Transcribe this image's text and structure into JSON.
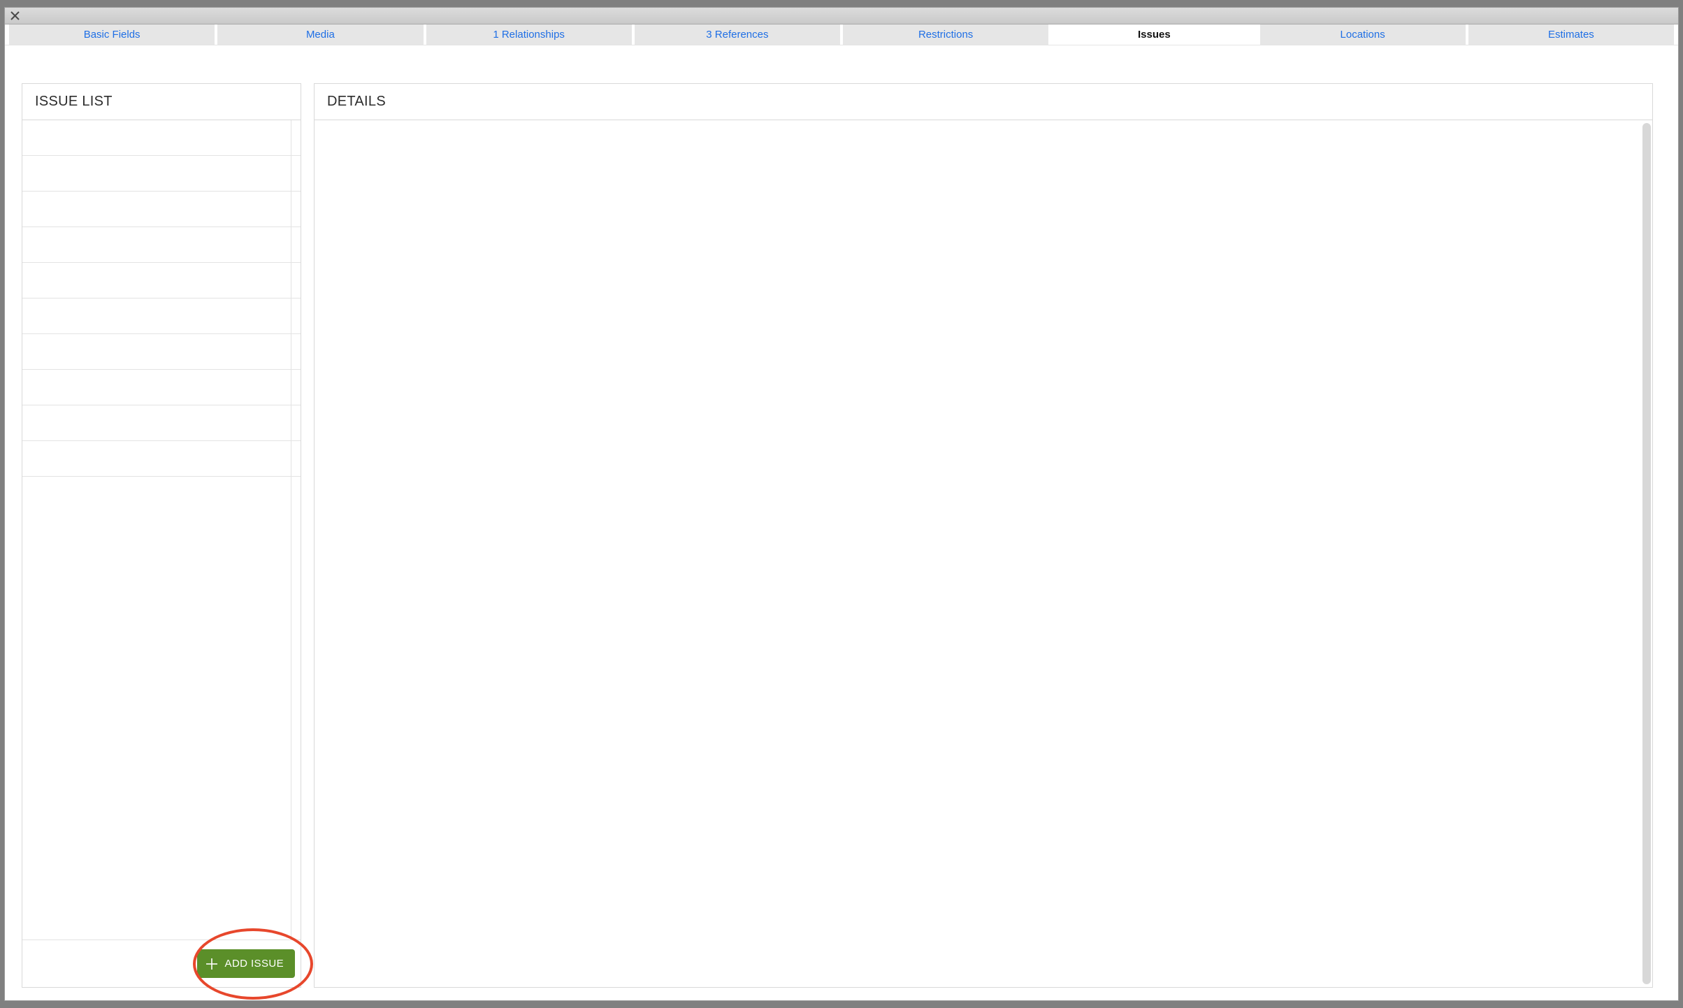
{
  "tabs": [
    {
      "label": "Basic Fields",
      "active": false
    },
    {
      "label": "Media",
      "active": false
    },
    {
      "label": "1 Relationships",
      "active": false
    },
    {
      "label": "3 References",
      "active": false
    },
    {
      "label": "Restrictions",
      "active": false
    },
    {
      "label": "Issues",
      "active": true
    },
    {
      "label": "Locations",
      "active": false
    },
    {
      "label": "Estimates",
      "active": false
    }
  ],
  "panels": {
    "issue_list_title": "ISSUE LIST",
    "details_title": "DETAILS"
  },
  "add_issue": {
    "label": "ADD ISSUE"
  },
  "annotation": {
    "highlight_add_issue": true
  }
}
